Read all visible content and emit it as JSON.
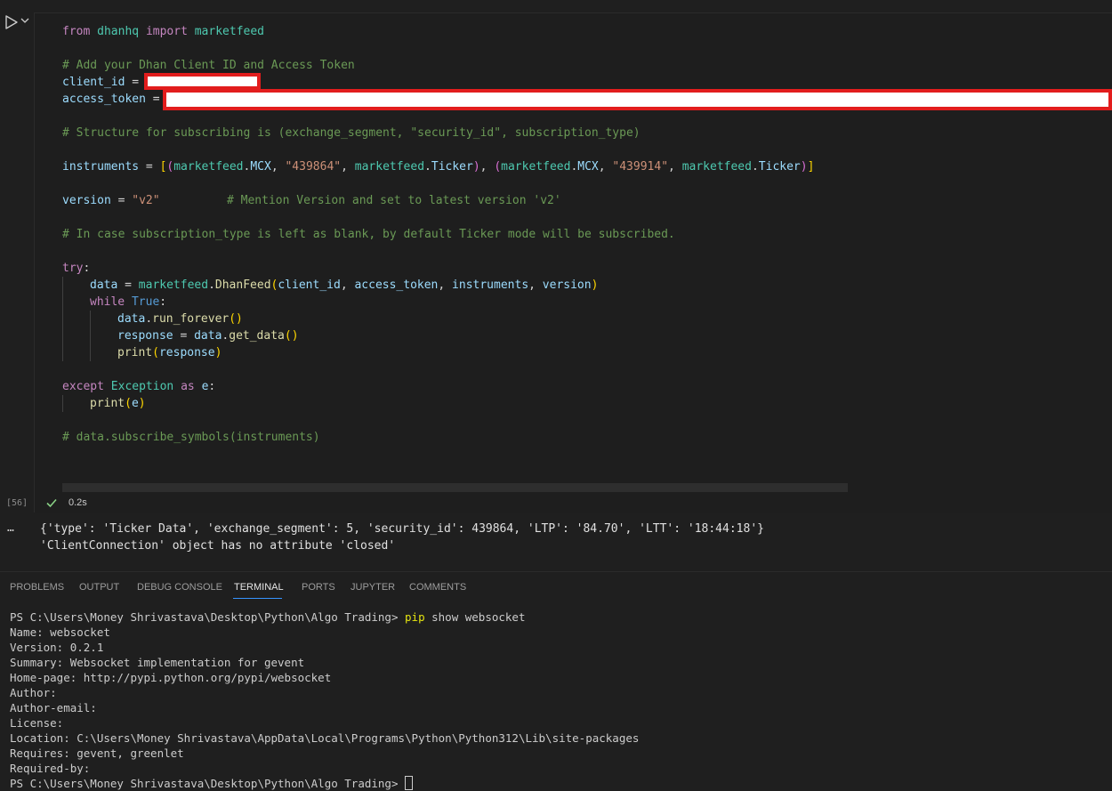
{
  "notebook": {
    "execution_count": "[56]",
    "exec_time": "0.2s",
    "code": {
      "line1": {
        "kw1": "from",
        "mod": "dhanhq",
        "kw2": "import",
        "name": "marketfeed"
      },
      "comment1": "# Add your Dhan Client ID and Access Token",
      "client_id_var": "client_id",
      "access_token_var": "access_token",
      "eq": " = ",
      "comment2": "# Structure for subscribing is (exchange_segment, \"security_id\", subscription_type)",
      "instruments": {
        "var": "instruments",
        "mf": "marketfeed",
        "mcx": "MCX",
        "ticker": "Ticker",
        "id1": "\"439864\"",
        "id2": "\"439914\""
      },
      "version": {
        "var": "version",
        "val": "\"v2\"",
        "comment": "# Mention Version and set to latest version 'v2'"
      },
      "comment3": "# In case subscription_type is left as blank, by default Ticker mode will be subscribed.",
      "try_kw": "try",
      "data_var": "data",
      "dhanfeed": "DhanFeed",
      "args": [
        "client_id",
        "access_token",
        "instruments",
        "version"
      ],
      "while_kw": "while",
      "true_kw": "True",
      "run_forever": "run_forever",
      "response_var": "response",
      "get_data": "get_data",
      "print_fn": "print",
      "except_kw": "except",
      "exception_cls": "Exception",
      "as_kw": "as",
      "e_var": "e",
      "comment4": "# data.subscribe_symbols(instruments)"
    },
    "output": {
      "more": "…",
      "line1": "{'type': 'Ticker Data', 'exchange_segment': 5, 'security_id': 439864, 'LTP': '84.70', 'LTT': '18:44:18'}",
      "line2": "'ClientConnection' object has no attribute 'closed'"
    }
  },
  "panel": {
    "tabs": [
      "PROBLEMS",
      "OUTPUT",
      "DEBUG CONSOLE",
      "TERMINAL",
      "PORTS",
      "JUPYTER",
      "COMMENTS"
    ],
    "active_tab": "TERMINAL"
  },
  "terminal": {
    "prompt": "PS C:\\Users\\Money Shrivastava\\Desktop\\Python\\Algo Trading> ",
    "cmd_name": "pip",
    "cmd_args": " show websocket",
    "lines": [
      "Name: websocket",
      "Version: 0.2.1",
      "Summary: Websocket implementation for gevent",
      "Home-page: http://pypi.python.org/pypi/websocket",
      "Author:",
      "Author-email:",
      "License:",
      "Location: C:\\Users\\Money Shrivastava\\AppData\\Local\\Programs\\Python\\Python312\\Lib\\site-packages",
      "Requires: gevent, greenlet",
      "Required-by:"
    ],
    "final_prompt": "PS C:\\Users\\Money Shrivastava\\Desktop\\Python\\Algo Trading> "
  },
  "colors": {
    "accent": "#3794ff",
    "redaction_border": "#e21d1d",
    "success": "#89d185"
  },
  "icons": [
    "run-icon",
    "chevron-down-icon",
    "check-icon",
    "more-icon"
  ]
}
